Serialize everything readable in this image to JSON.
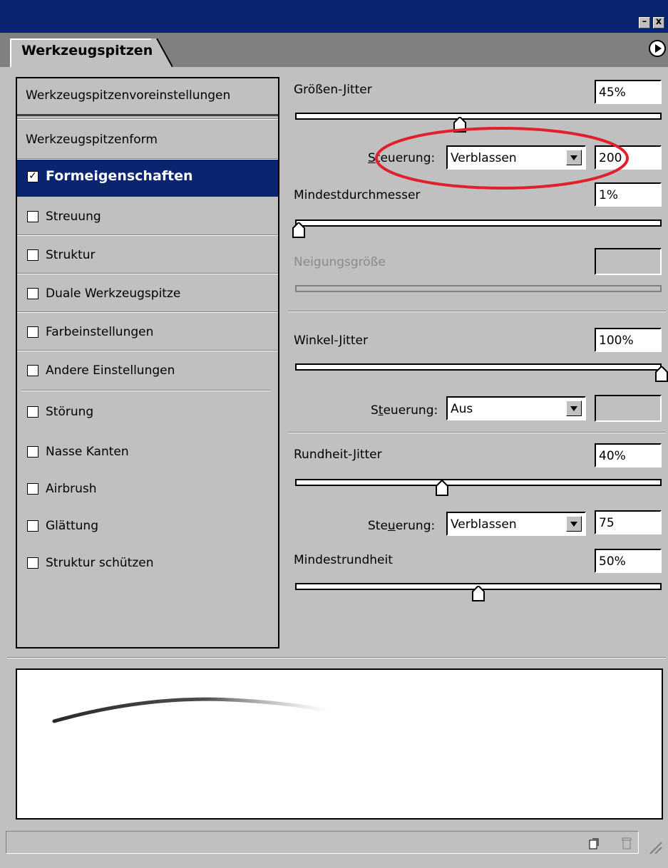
{
  "window": {
    "minimize_glyph": "–",
    "close_glyph": "x"
  },
  "tab": {
    "label": "Werkzeugspitzen"
  },
  "left_panel": {
    "presets": "Werkzeugspitzenvoreinstellungen",
    "tip_shape": "Werkzeugspitzenform",
    "items": [
      {
        "label": "Formeigenschaften",
        "checked": true,
        "selected": true
      },
      {
        "label": "Streuung",
        "checked": false
      },
      {
        "label": "Struktur",
        "checked": false
      },
      {
        "label": "Duale Werkzeugspitze",
        "checked": false
      },
      {
        "label": "Farbeinstellungen",
        "checked": false
      },
      {
        "label": "Andere Einstellungen",
        "checked": false
      },
      {
        "label": "Störung",
        "checked": false
      },
      {
        "label": "Nasse Kanten",
        "checked": false
      },
      {
        "label": "Airbrush",
        "checked": false
      },
      {
        "label": "Glättung",
        "checked": false
      },
      {
        "label": "Struktur schützen",
        "checked": false
      }
    ],
    "checkmark": "✓"
  },
  "settings": {
    "size_jitter": {
      "label": "Größen-Jitter",
      "value": "45%",
      "slider": 0.45
    },
    "size_control": {
      "label_pre": "",
      "label_u": "S",
      "label_post": "teuerung:",
      "select": "Verblassen",
      "value": "200"
    },
    "min_diameter": {
      "label": "Mindestdurchmesser",
      "value": "1%",
      "slider": 0.01
    },
    "tilt_scale": {
      "label": "Neigungsgröße",
      "value": ""
    },
    "angle_jitter": {
      "label": "Winkel-Jitter",
      "value": "100%",
      "slider": 1.0
    },
    "angle_control": {
      "label_pre": "S",
      "label_u": "t",
      "label_post": "euerung:",
      "select": "Aus",
      "value": ""
    },
    "roundness_jitter": {
      "label": "Rundheit-Jitter",
      "value": "40%",
      "slider": 0.4
    },
    "roundness_control": {
      "label_pre": "Ste",
      "label_u": "u",
      "label_post": "erung:",
      "select": "Verblassen",
      "value": "75"
    },
    "min_roundness": {
      "label": "Mindestrundheit",
      "value": "50%",
      "slider": 0.5
    }
  },
  "colors": {
    "titlebar": "#0a2470",
    "selection": "#0a2470",
    "annotation": "#e0202a",
    "panel": "#c0c0c0"
  },
  "icons": {
    "menu": "flyout-menu-icon",
    "new": "new-preset-icon",
    "trash": "trash-icon"
  }
}
